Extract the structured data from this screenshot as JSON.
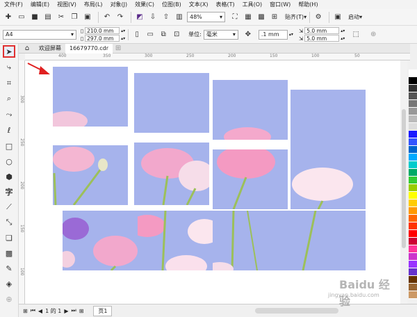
{
  "menu": [
    "文件(F)",
    "编辑(E)",
    "视图(V)",
    "布局(L)",
    "对象(J)",
    "效果(C)",
    "位图(B)",
    "文本(X)",
    "表格(T)",
    "工具(O)",
    "窗口(W)",
    "帮助(H)"
  ],
  "toolbar": {
    "zoom": "48%",
    "snap_label": "贴齐(T)",
    "launch_label": "启动"
  },
  "property_bar": {
    "paper_size": "A4",
    "width": "210.0 mm",
    "height": "297.0 mm",
    "units_label": "单位:",
    "units_value": "毫米",
    "nudge": ".1 mm",
    "dup_x": "5.0 mm",
    "dup_y": "5.0 mm"
  },
  "tabs": [
    {
      "label": "欢迎屏幕"
    },
    {
      "label": "16679770.cdr"
    }
  ],
  "ruler_h": [
    "400",
    "350",
    "300",
    "250",
    "200",
    "150",
    "100",
    "50"
  ],
  "ruler_v": [
    "300",
    "250",
    "200",
    "150",
    "100"
  ],
  "bottom": {
    "page_counter": "1 的 1",
    "page_tab": "页1"
  },
  "watermark": {
    "brand": "Baidu 经验",
    "sub": "jingyan.baidu.com"
  },
  "colors": {
    "sky": "#a6b3ec",
    "highlight": "#e03030"
  },
  "palette": [
    "#ffffff",
    "#000000",
    "#333333",
    "#555555",
    "#777777",
    "#999999",
    "#bbbbbb",
    "#dddddd",
    "#1a1aff",
    "#3355ff",
    "#0066cc",
    "#00aaff",
    "#00cccc",
    "#00aa66",
    "#33cc33",
    "#99cc00",
    "#ffff00",
    "#ffcc00",
    "#ff9900",
    "#ff6600",
    "#ff3300",
    "#ff0000",
    "#cc0033",
    "#ff3399",
    "#cc33cc",
    "#9933ff",
    "#6633cc",
    "#663300",
    "#996633",
    "#cc9966"
  ]
}
